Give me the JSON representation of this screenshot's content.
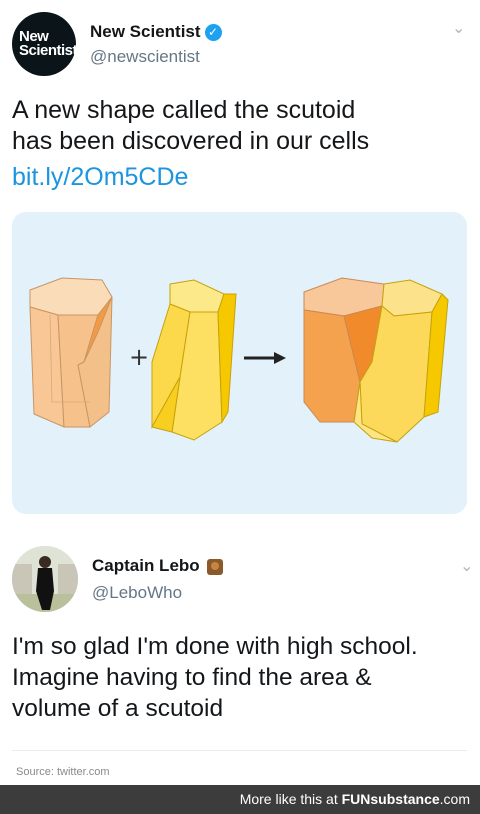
{
  "tweet1": {
    "avatar_line1": "New",
    "avatar_line2": "Scientist",
    "name": "New Scientist",
    "handle": "@newscientist",
    "text_line1": "A new shape called the scutoid",
    "text_line2": "has been discovered in our cells",
    "link": "bit.ly/2Om5CDe",
    "verified_icon": "verified-badge-icon",
    "colors": {
      "link": "#1b95e0",
      "media_bg": "#e2f1fa",
      "verified": "#1da1f2"
    }
  },
  "diagram": {
    "plus": "+",
    "arrow_icon": "right-arrow-icon",
    "colors": {
      "orange_light": "#f8c99a",
      "orange": "#f4a35a",
      "yellow": "#fbd84a",
      "yellow_dark": "#f2c200"
    }
  },
  "tweet2": {
    "name": "Captain Lebo",
    "handle": "@LeboWho",
    "emoji_icon": "woman-emoji-icon",
    "text_line1": "I'm so glad I'm done with high school.",
    "text_line2": "Imagine having to find the area &",
    "text_line3": "volume of a scutoid"
  },
  "source": "Source: twitter.com",
  "footer": {
    "prefix": "More like this at",
    "brand": "FUNsubstance",
    "suffix": ".com",
    "bg": "#3c3c3c"
  }
}
